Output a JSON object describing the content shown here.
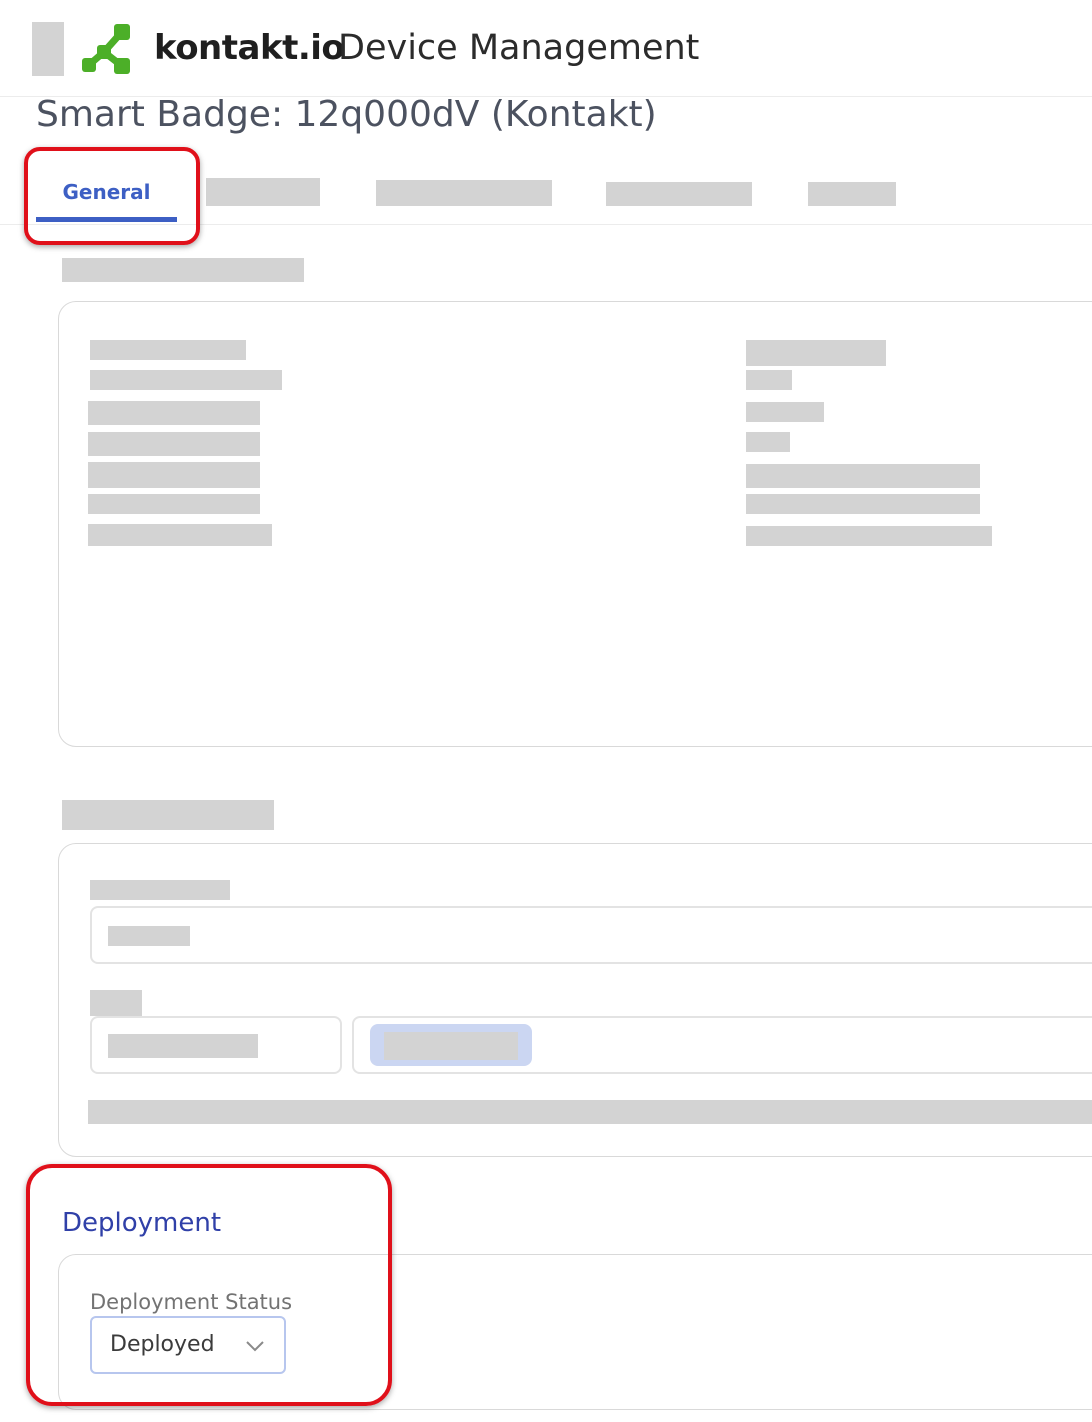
{
  "header": {
    "brand": "kontakt.io",
    "app_title": "Device Management"
  },
  "page_title": "Smart Badge: 12q000dV (Kontakt)",
  "tabs": [
    {
      "label": "General",
      "active": true
    }
  ],
  "deployment": {
    "section_title": "Deployment",
    "status_label": "Deployment Status",
    "status_value": "Deployed"
  },
  "icons": {
    "logo": "kontakt-logo-icon",
    "chevron": "chevron-down-icon"
  },
  "colors": {
    "accent": "#3d5fc4",
    "logo_green": "#4caf28",
    "annotation": "#e0101a",
    "redacted": "#d3d3d3"
  }
}
